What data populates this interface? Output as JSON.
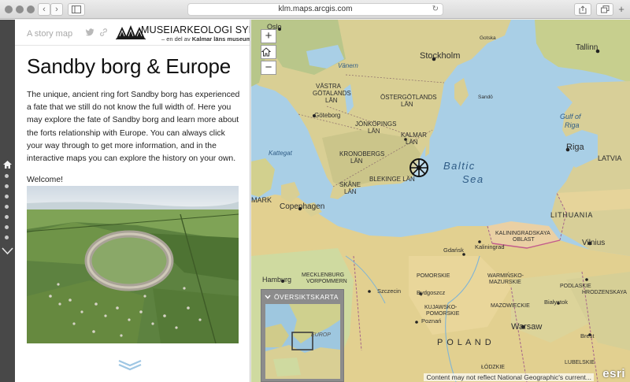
{
  "browser": {
    "url": "klm.maps.arcgis.com",
    "back": "‹",
    "forward": "›",
    "reload": "↻",
    "new_tab": "+"
  },
  "panel": {
    "kicker": "A story map",
    "logo_title": "MUSEIARKEOLOGI SYDOST",
    "logo_sub_prefix": "– en del av",
    "logo_sub_bold": "Kalmar läns museum",
    "title": "Sandby borg & Europe",
    "body": "The unique, ancient ring fort Sandby borg has experienced a fate that we still do not know the full width of. Here you may explore the fate of Sandby borg and learn more about the forts relationship with Europe. You can always click your way through to get more information, and in the interactive maps you can explore the history on your own.",
    "welcome": "Welcome!"
  },
  "map": {
    "zoom_in": "+",
    "zoom_out": "−",
    "overview_title": "ÖVERSIKTSKARTA",
    "overview_label": "EUROP",
    "attribution": "Content may not reflect National Geographic's current...",
    "esri": "esri",
    "labels": {
      "oslo": "Oslo",
      "stockholm": "Stockholm",
      "tallinn": "Tallinn",
      "vastra": "VÄSTRA",
      "gotalands": "GÖTALANDS",
      "lan1": "LÄN",
      "goteborg": "Göteborg",
      "ostergotlands": "ÖSTERGÖTLANDS",
      "lan2": "LÄN",
      "jonkopings": "JÖNKÖPINGS",
      "lan3": "LÄN",
      "kalmar": "KALMAR",
      "lan4": "LÄN",
      "kattegat": "Kattegat",
      "kronobergs": "KRONOBERGS",
      "lan5": "LÄN",
      "blekinge": "BLEKINGE LÄN",
      "skane": "SKÅNE",
      "lan6": "LÄN",
      "baltic": "Baltic",
      "sea": "Sea",
      "gulf_of": "Gulf of",
      "riga_gulf": "Riga",
      "riga": "Riga",
      "latvia": "LATVIA",
      "lithuania": "LITHUANIA",
      "vilnius": "Vilnius",
      "mark": "MARK",
      "copenhagen": "Copenhagen",
      "kaliningradskaya": "KALININGRADSKAYA",
      "oblast": "OBLAST",
      "kaliningrad": "Kaliningrad",
      "gdansk": "Gdańsk",
      "hamburg": "Hamburg",
      "mecklenburg": "MECKLENBURG",
      "vorpommern": "VORPOMMERN",
      "szczecin": "Szczecin",
      "bydgoszcz": "Bydgoszcz",
      "warminsko": "WARMIŃSKO-",
      "mazurskie": "MAZURSKIE",
      "bialystok": "Białystok",
      "podlaskie": "PODLASKIE",
      "brest": "Brest",
      "hrodzenskaya": "HRODZENSKAYA",
      "poznan": "Poznań",
      "warsaw": "Warsaw",
      "poland": "P O L A N D",
      "kujawsko": "KUJAWSKO-",
      "pomorskie": "POMORSKIE",
      "mazowieckie": "MAZOWIECKIE",
      "lodzkie": "ŁÓDZKIE",
      "lubelskie": "LUBELSKIE",
      "pomorskie2": "POMORSKIE",
      "vanern": "Vänern",
      "gotland": "Sandö",
      "gotska": "Gotska"
    }
  }
}
